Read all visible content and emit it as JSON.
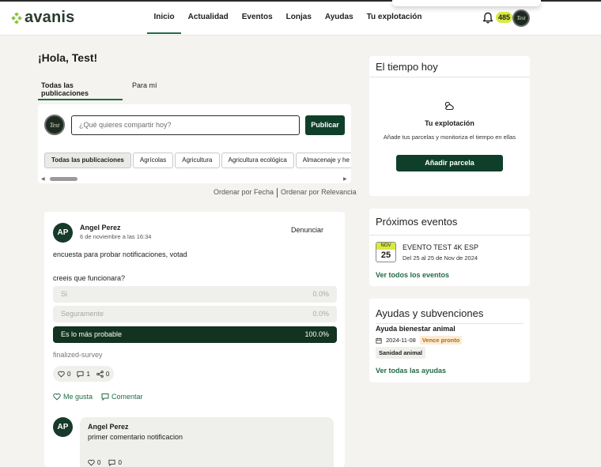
{
  "header": {
    "logo_text": "avanis",
    "nav": [
      "Inicio",
      "Actualidad",
      "Eventos",
      "Lonjas",
      "Ayudas",
      "Tu explotación"
    ],
    "active_nav": "Inicio",
    "points": "485",
    "avatar_text": "Test"
  },
  "feed": {
    "greeting": "¡Hola, Test!",
    "tabs": [
      "Todas las publicaciones",
      "Para mí"
    ],
    "composer": {
      "placeholder": "¿Qué quieres compartir hoy?",
      "publish_label": "Publicar",
      "avatar_text": "Test"
    },
    "filters": [
      "Todas las publicaciones",
      "Agrícolas",
      "Agricultura",
      "Agricultura ecológica",
      "Almacenaje y he"
    ],
    "sort": [
      "Ordenar por Fecha",
      "Ordenar por Relevancia"
    ]
  },
  "post": {
    "initials": "AP",
    "author": "Angel Perez",
    "date": "6 de noviembre a las 16:34",
    "report_label": "Denunciar",
    "text": "encuesta para probar notificaciones, votad",
    "question": "creeis que funcionara?",
    "options": [
      {
        "label": "Si",
        "pct": "0.0%"
      },
      {
        "label": "Seguramente",
        "pct": "0.0%"
      },
      {
        "label": "Es lo más probable",
        "pct": "100.0%"
      }
    ],
    "status": "finalized-survey",
    "reactions": {
      "likes": "0",
      "comments": "1",
      "shares": "0"
    },
    "like_label": "Me gusta",
    "comment_label": "Comentar",
    "comment": {
      "initials": "AP",
      "author": "Angel Perez",
      "text": "primer comentario notificacion",
      "likes": "0",
      "replies": "0"
    }
  },
  "weather": {
    "title": "El tiempo hoy",
    "heading": "Tu explotación",
    "subtitle": "Añade tus parcelas y monitoriza el tiempo en ellas",
    "button": "Añadir parcela"
  },
  "events": {
    "title": "Próximos eventos",
    "month": "NOV",
    "day": "25",
    "event_title": "EVENTO TEST 4K ESP",
    "event_dates": "Del 25 al 25 de Nov de 2024",
    "link": "Ver todos los eventos"
  },
  "grants": {
    "title": "Ayudas y subvenciones",
    "item_title": "Ayuda bienestar animal",
    "item_date": "2024-11-08",
    "badge": "Vence pronto",
    "tag": "Sanidad animal",
    "link": "Ver todas las ayudas"
  },
  "colors": {
    "primary": "#0f3f2a",
    "accent": "#d8ea42",
    "link": "#1f6b45",
    "background": "#f4f3ef"
  }
}
